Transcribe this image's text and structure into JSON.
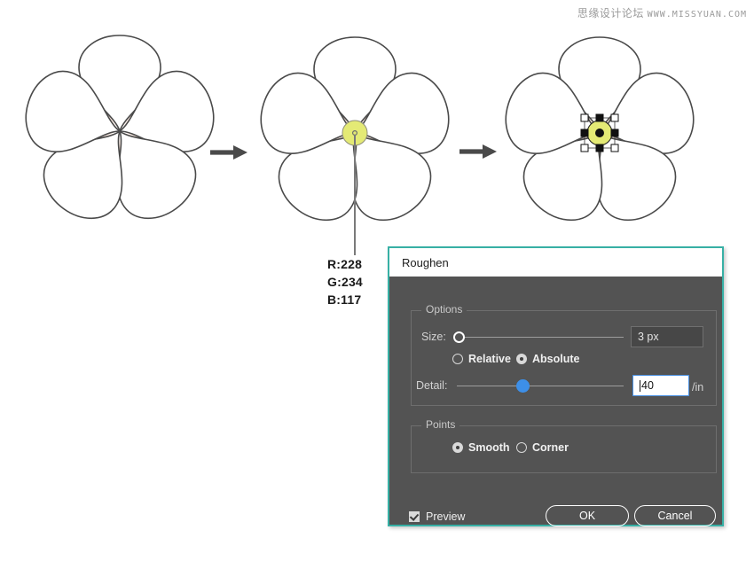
{
  "watermark": {
    "forum": "思缘设计论坛",
    "url": "WWW.MISSYUAN.COM"
  },
  "illustration": {
    "steps": [
      {
        "id": "step-1",
        "label": "flower-outline"
      },
      {
        "id": "step-2",
        "label": "flower-with-center-circle"
      },
      {
        "id": "step-3",
        "label": "flower-center-selected"
      }
    ],
    "arrows": [
      {
        "id": "arrow-1"
      },
      {
        "id": "arrow-2"
      }
    ],
    "colors": {
      "petal_stroke": "#4a4a4a",
      "petal_fill": "#ffffff",
      "vein": "#fae3d8",
      "center_circle": "#e4ea75",
      "center_circle_stroke": "#8f8f7a",
      "arrow": "#4a4a4a",
      "leader_line": "#7a7a7a",
      "handle_fill_white": "#ffffff",
      "handle_fill_black": "#000000"
    }
  },
  "callout": {
    "r": "R:228",
    "g": "G:234",
    "b": "B:117"
  },
  "dialog": {
    "title": "Roughen",
    "accent_border": "#37b0a5",
    "options_group": {
      "legend": "Options",
      "size": {
        "label": "Size:",
        "value": "3 px",
        "slider_percent": 0
      },
      "size_mode": {
        "relative": {
          "label": "Relative",
          "checked": false
        },
        "absolute": {
          "label": "Absolute",
          "checked": true
        }
      },
      "detail": {
        "label": "Detail:",
        "value": "40",
        "unit": "/in",
        "slider_percent": 38,
        "focused": true
      }
    },
    "points_group": {
      "legend": "Points",
      "smooth": {
        "label": "Smooth",
        "checked": true
      },
      "corner": {
        "label": "Corner",
        "checked": false
      }
    },
    "preview": {
      "label": "Preview",
      "checked": true
    },
    "ok_label": "OK",
    "cancel_label": "Cancel"
  }
}
